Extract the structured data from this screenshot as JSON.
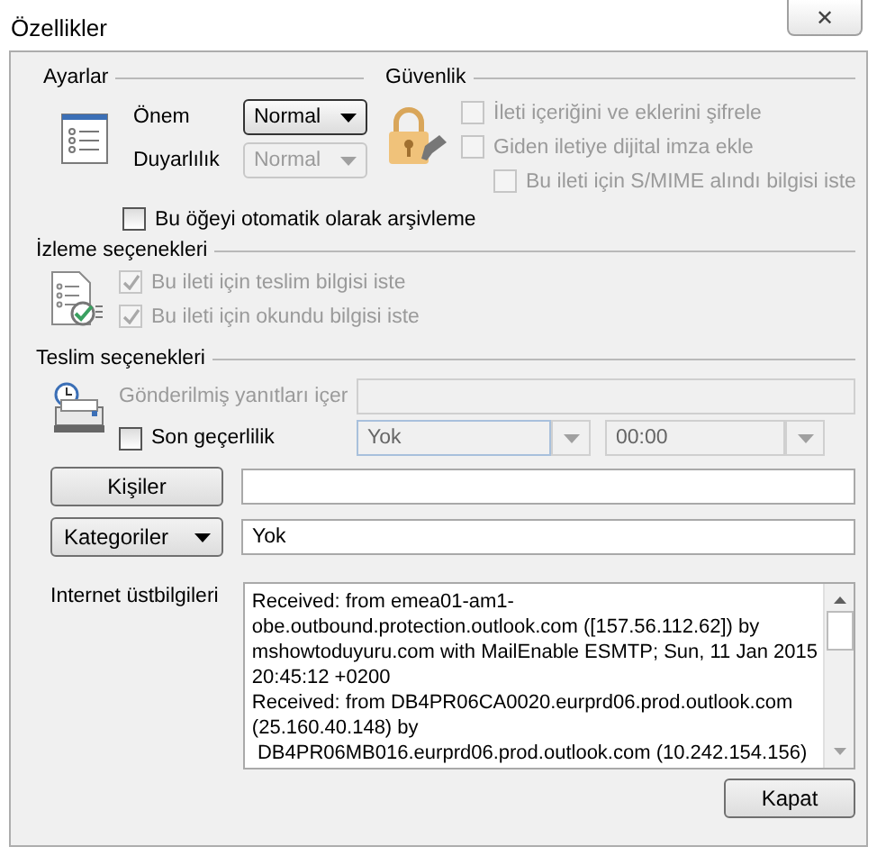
{
  "window": {
    "title": "Özellikler",
    "close_symbol": "✕"
  },
  "settings": {
    "heading": "Ayarlar",
    "fields": [
      {
        "label": "Önem",
        "value": "Normal",
        "disabled": false
      },
      {
        "label": "Duyarlılık",
        "value": "Normal",
        "disabled": true
      }
    ]
  },
  "security": {
    "heading": "Güvenlik",
    "options": [
      {
        "label": "İleti içeriğini ve eklerini şifrele",
        "checked": false,
        "disabled": true
      },
      {
        "label": "Giden iletiye dijital imza ekle",
        "checked": false,
        "disabled": true,
        "children": [
          {
            "label": "Bu ileti için S/MIME alındı bilgisi iste",
            "checked": false,
            "disabled": true
          }
        ]
      }
    ]
  },
  "archive": {
    "label": "Bu öğeyi otomatik olarak arşivleme",
    "checked": false,
    "disabled": false
  },
  "tracking": {
    "heading": "İzleme seçenekleri",
    "options": [
      {
        "label": "Bu ileti için teslim bilgisi iste",
        "checked": true,
        "disabled": true
      },
      {
        "label": "Bu ileti için okundu bilgisi iste",
        "checked": true,
        "disabled": true
      }
    ]
  },
  "delivery": {
    "heading": "Teslim seçenekleri",
    "replies": {
      "label": "Gönderilmiş yanıtları içer",
      "disabled": true
    },
    "expiry": {
      "label": "Son geçerlilik",
      "checked": false,
      "disabled": false,
      "date": "Yok",
      "time": "00:00",
      "fields_disabled": true
    }
  },
  "contacts": {
    "button": "Kişiler"
  },
  "categories": {
    "button": "Kategoriler",
    "value": "Yok"
  },
  "headers": {
    "label": "Internet üstbilgileri",
    "lines": [
      "Received: from emea01-am1-",
      "obe.outbound.protection.outlook.com ([157.56.112.62]) by",
      "mshowtoduyuru.com with MailEnable ESMTP; Sun, 11 Jan 2015",
      "20:45:12 +0200",
      "Received: from DB4PR06CA0020.eurprd06.prod.outlook.com",
      "(25.160.40.148) by",
      " DB4PR06MB016.eurprd06.prod.outlook.com (10.242.154.156)"
    ]
  },
  "buttons": {
    "close": "Kapat"
  }
}
